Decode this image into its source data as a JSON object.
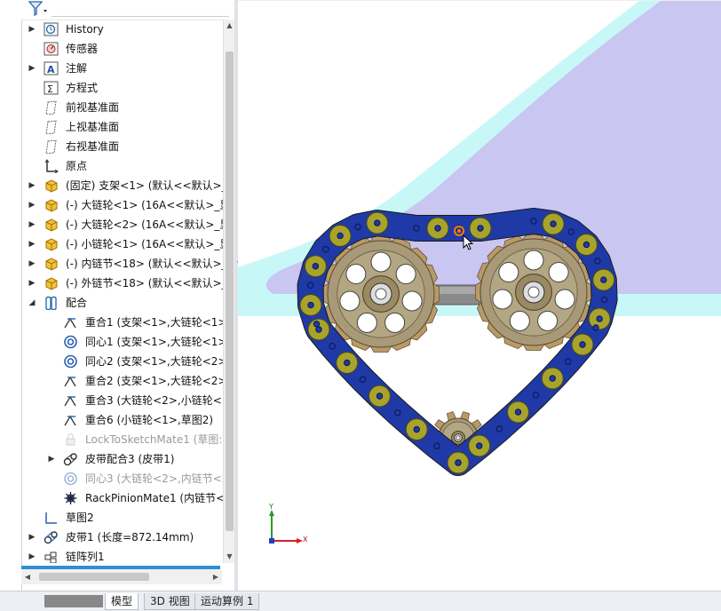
{
  "feature_tree": {
    "items": [
      {
        "label": "History",
        "icon": "history-icon",
        "expander": "collapsed",
        "level": 0
      },
      {
        "label": "传感器",
        "icon": "sensor-icon",
        "expander": "none",
        "level": 0
      },
      {
        "label": "注解",
        "icon": "annotation-icon",
        "expander": "collapsed",
        "level": 0
      },
      {
        "label": "方程式",
        "icon": "equation-icon",
        "expander": "none",
        "level": 0
      },
      {
        "label": "前视基准面",
        "icon": "plane-icon",
        "expander": "none",
        "level": 0
      },
      {
        "label": "上视基准面",
        "icon": "plane-icon",
        "expander": "none",
        "level": 0
      },
      {
        "label": "右视基准面",
        "icon": "plane-icon",
        "expander": "none",
        "level": 0
      },
      {
        "label": "原点",
        "icon": "origin-icon",
        "expander": "none",
        "level": 0
      },
      {
        "label": "(固定) 支架<1> (默认<<默认>_",
        "icon": "part-icon",
        "expander": "collapsed",
        "level": 0
      },
      {
        "label": "(-) 大链轮<1> (16A<<默认>_显",
        "icon": "part-icon",
        "expander": "collapsed",
        "level": 0
      },
      {
        "label": "(-) 大链轮<2> (16A<<默认>_显",
        "icon": "part-icon",
        "expander": "collapsed",
        "level": 0
      },
      {
        "label": "(-) 小链轮<1> (16A<<默认>_显",
        "icon": "part-icon",
        "expander": "collapsed",
        "level": 0
      },
      {
        "label": "(-) 内链节<18> (默认<<默认>_",
        "icon": "part-icon",
        "expander": "collapsed",
        "level": 0
      },
      {
        "label": "(-) 外链节<18> (默认<<默认>_",
        "icon": "part-icon",
        "expander": "collapsed",
        "level": 0
      },
      {
        "label": "配合",
        "icon": "mates-folder-icon",
        "expander": "expanded",
        "level": 0
      },
      {
        "label": "重合1 (支架<1>,大链轮<1>",
        "icon": "coincident-mate-icon",
        "expander": "none",
        "level": 1
      },
      {
        "label": "同心1 (支架<1>,大链轮<1>",
        "icon": "concentric-mate-icon",
        "expander": "none",
        "level": 1
      },
      {
        "label": "同心2 (支架<1>,大链轮<2>",
        "icon": "concentric-mate-icon",
        "expander": "none",
        "level": 1
      },
      {
        "label": "重合2 (支架<1>,大链轮<2>",
        "icon": "coincident-mate-icon",
        "expander": "none",
        "level": 1
      },
      {
        "label": "重合3 (大链轮<2>,小链轮<:",
        "icon": "coincident-mate-icon",
        "expander": "none",
        "level": 1
      },
      {
        "label": "重合6 (小链轮<1>,草图2)",
        "icon": "coincident-mate-icon",
        "expander": "none",
        "level": 1
      },
      {
        "label": "LockToSketchMate1 (草图:",
        "icon": "lock-mate-icon",
        "expander": "none",
        "level": 1,
        "dim": true
      },
      {
        "label": "皮带配合3 (皮带1)",
        "icon": "belt-mate-icon",
        "expander": "collapsed",
        "level": 1
      },
      {
        "label": "同心3 (大链轮<2>,内链节<2",
        "icon": "concentric-mate-icon",
        "expander": "none",
        "level": 1,
        "dim": true
      },
      {
        "label": "RackPinionMate1 (内链节<",
        "icon": "rack-pinion-mate-icon",
        "expander": "none",
        "level": 1
      },
      {
        "label": "草图2",
        "icon": "sketch-icon",
        "expander": "none",
        "level": 0
      },
      {
        "label": "皮带1 (长度=872.14mm)",
        "icon": "belt-icon",
        "expander": "collapsed",
        "level": 0
      },
      {
        "label": "链阵列1",
        "icon": "chain-pattern-icon",
        "expander": "collapsed",
        "level": 0
      }
    ]
  },
  "bottom_tabs": [
    {
      "label": "模型",
      "active": true
    },
    {
      "label": "3D 视图",
      "active": false
    },
    {
      "label": "运动算例 1",
      "active": false
    }
  ],
  "triad": {
    "x_label": "X",
    "y_label": "Y"
  },
  "colors": {
    "accent_blue": "#2e8fd6",
    "chain_olive": "#a8a32c",
    "chain_blue": "#1f3aa6",
    "sprocket_tan": "#b89a6a",
    "background_plane": "#c9c6f2",
    "background_edge": "#c8f7f7"
  }
}
